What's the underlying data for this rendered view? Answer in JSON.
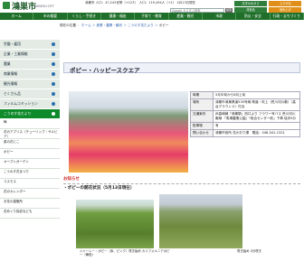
{
  "header": {
    "title": "鴻巣市",
    "subtitle": "KONOSU CITY",
    "stats": "鴻巣市 人口：47,243世帯（+123）　人口：119,494人（+1）",
    "date": "4月13日現在",
    "search_placeholder": "Google カスタム検索",
    "search_button": "検索",
    "tools": [
      "文字の大きさ",
      "ふりがな",
      "背景色",
      "読み上げ",
      "English",
      "Easy Web Browsing"
    ]
  },
  "nav": [
    "ホーム",
    "市の概要",
    "くらし・手続き",
    "健康・福祉",
    "子育て・教育",
    "産業・観光",
    "市政",
    "防災・安全",
    "行政・まちづくり"
  ],
  "breadcrumb": {
    "links": [
      "現在の位置",
      "ホーム",
      "産業・農業・観光",
      "こうのす花だより"
    ],
    "current": "ポピー"
  },
  "sidebar": {
    "categories": [
      "労働・雇用",
      "企業・工業情報",
      "農業",
      "商業情報",
      "観光情報",
      "とくさん品",
      "フィルムコミッション",
      "こうのす花だより"
    ],
    "active_index": 7,
    "subitems": [
      "梅",
      "花のアプリス（チューリップ・サルビア）",
      "菜の花とこ",
      "ポピー",
      "オープンガーデン",
      "こうのす花まつり",
      "コスモス",
      "花のカレンダー",
      "お花の直販所",
      "花めぐり探訪なども"
    ]
  },
  "page": {
    "title": "ポピー・ハッピースクエア",
    "info": [
      {
        "key": "時期",
        "value": "5月中旬から6月上旬"
      },
      {
        "key": "場所",
        "value": "鴻巣市鴻巣県道535号線 県道・吹上（荒川河川敷）（高台グラウンド）付近"
      },
      {
        "key": "交通案内",
        "value": "JR高崎線「鴻巣駅」西口より フラワー号バス 荒川河川敷線 「馬場農業公園」「総合センター前」下車 徒歩5分"
      },
      {
        "key": "駐車場",
        "value": "有"
      },
      {
        "key": "問い合わせ",
        "value": "鴻巣市役所 花かおり課　電話：048-541-1321"
      }
    ]
  },
  "notice": {
    "heading": "お知らせ",
    "section": "・ポピーの開花状況（5月13日現在）",
    "caption1": "シャーレー・ポピー（赤、ピンク）咲き始め カリフォルニアポピー（黄色）",
    "caption2": "咲き始め 2分咲き"
  }
}
